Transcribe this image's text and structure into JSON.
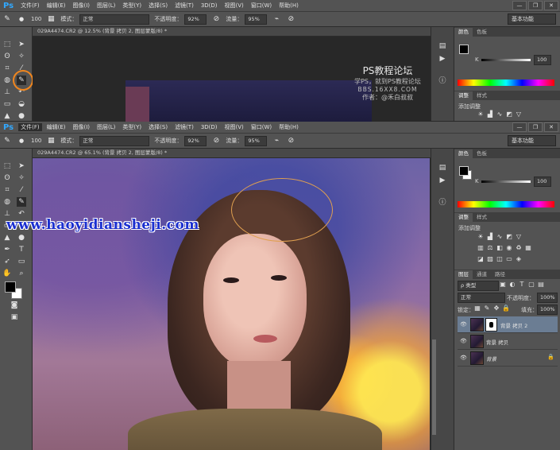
{
  "app": {
    "logo": "Ps"
  },
  "menu": [
    "文件(F)",
    "编辑(E)",
    "图像(I)",
    "图层(L)",
    "类型(Y)",
    "选择(S)",
    "滤镜(T)",
    "3D(D)",
    "视图(V)",
    "窗口(W)",
    "帮助(H)"
  ],
  "window_controls": {
    "minimize": "—",
    "restore": "❐",
    "close": "✕"
  },
  "options": {
    "brush_size": "100",
    "mode_label": "模式：",
    "mode_value": "正常",
    "opacity_label": "不透明度：",
    "opacity_value": "92%",
    "flow_label": "流量：",
    "flow_value": "95%",
    "workspace": "基本功能"
  },
  "documents": {
    "top_tab": "029A4474.CR2 @ 12.5% (背景 拷贝 2, 图层蒙版/8) *",
    "bottom_tab": "029A4474.CR2 @ 65.1% (背景 拷贝 2, 图层蒙版/8) *"
  },
  "watermark": {
    "title": "PS教程论坛",
    "line1": "学PS，就到PS教程论坛",
    "line2": "BBS.16XX8.COM",
    "line3": "作者：@禾白叔叔",
    "site": "www.haoyidiansheji.com"
  },
  "panels": {
    "color_tabs": [
      "颜色",
      "色板"
    ],
    "k_label": "K",
    "k_value": "100",
    "adjust_tabs": [
      "调整",
      "样式"
    ],
    "add_adjustment": "添加调整",
    "layer_tabs": [
      "图层",
      "通道",
      "路径"
    ],
    "kind_filter": "ρ 类型",
    "blend_mode": "正常",
    "opacity_label": "不透明度：",
    "opacity_value": "100%",
    "lock_label": "锁定：",
    "fill_label": "填充：",
    "fill_value": "100%",
    "layers": [
      {
        "name": "背景 拷贝 2",
        "selected": true,
        "mask": true
      },
      {
        "name": "背景 拷贝",
        "selected": false,
        "mask": false
      },
      {
        "name": "背景",
        "selected": false,
        "mask": false,
        "locked": true
      }
    ]
  },
  "colors": {
    "highlight_circle": "#f0861e",
    "selection_ellipse": "#e0a050",
    "watermark_blue": "#1a2fd0"
  }
}
